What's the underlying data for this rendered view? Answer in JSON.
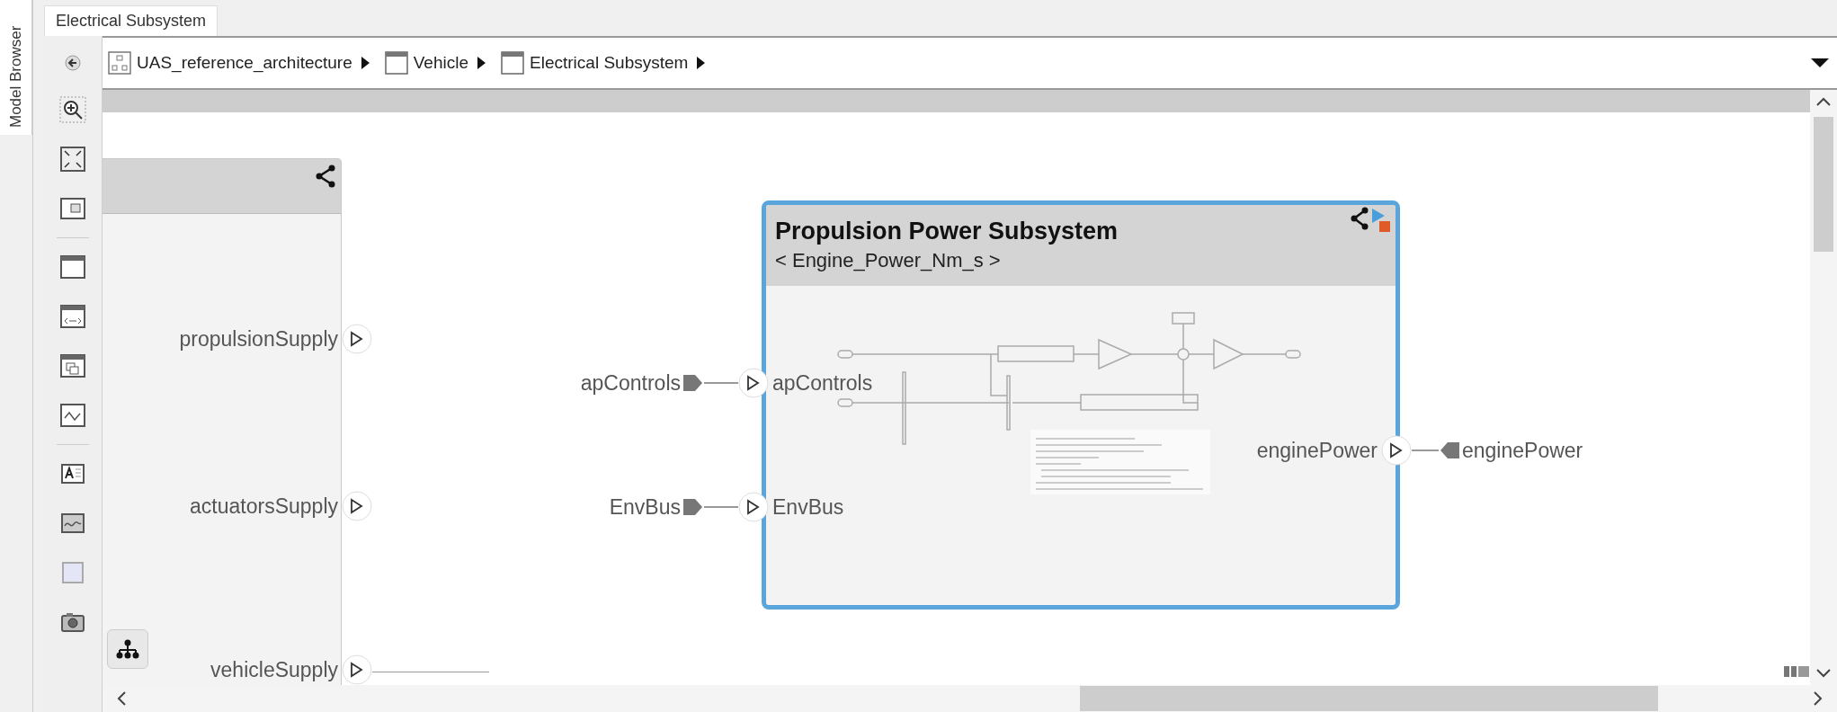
{
  "side_tab": {
    "label": "Model Browser"
  },
  "tabs": [
    {
      "label": "Electrical Subsystem",
      "selected": true
    }
  ],
  "breadcrumb": [
    {
      "label": "UAS_reference_architecture",
      "kind": "model"
    },
    {
      "label": "Vehicle",
      "kind": "component"
    },
    {
      "label": "Electrical Subsystem",
      "kind": "component"
    }
  ],
  "parent_block": {
    "ports": [
      {
        "name": "propulsionSupply"
      },
      {
        "name": "actuatorsSupply"
      },
      {
        "name": "vehicleSupply"
      }
    ]
  },
  "block": {
    "title": "Propulsion Power Subsystem",
    "subtitle": "< Engine_Power_Nm_s >",
    "selected": true,
    "inports": [
      {
        "name": "apControls",
        "external": "apControls"
      },
      {
        "name": "EnvBus",
        "external": "EnvBus"
      }
    ],
    "outports": [
      {
        "name": "enginePower",
        "external": "enginePower"
      }
    ]
  }
}
